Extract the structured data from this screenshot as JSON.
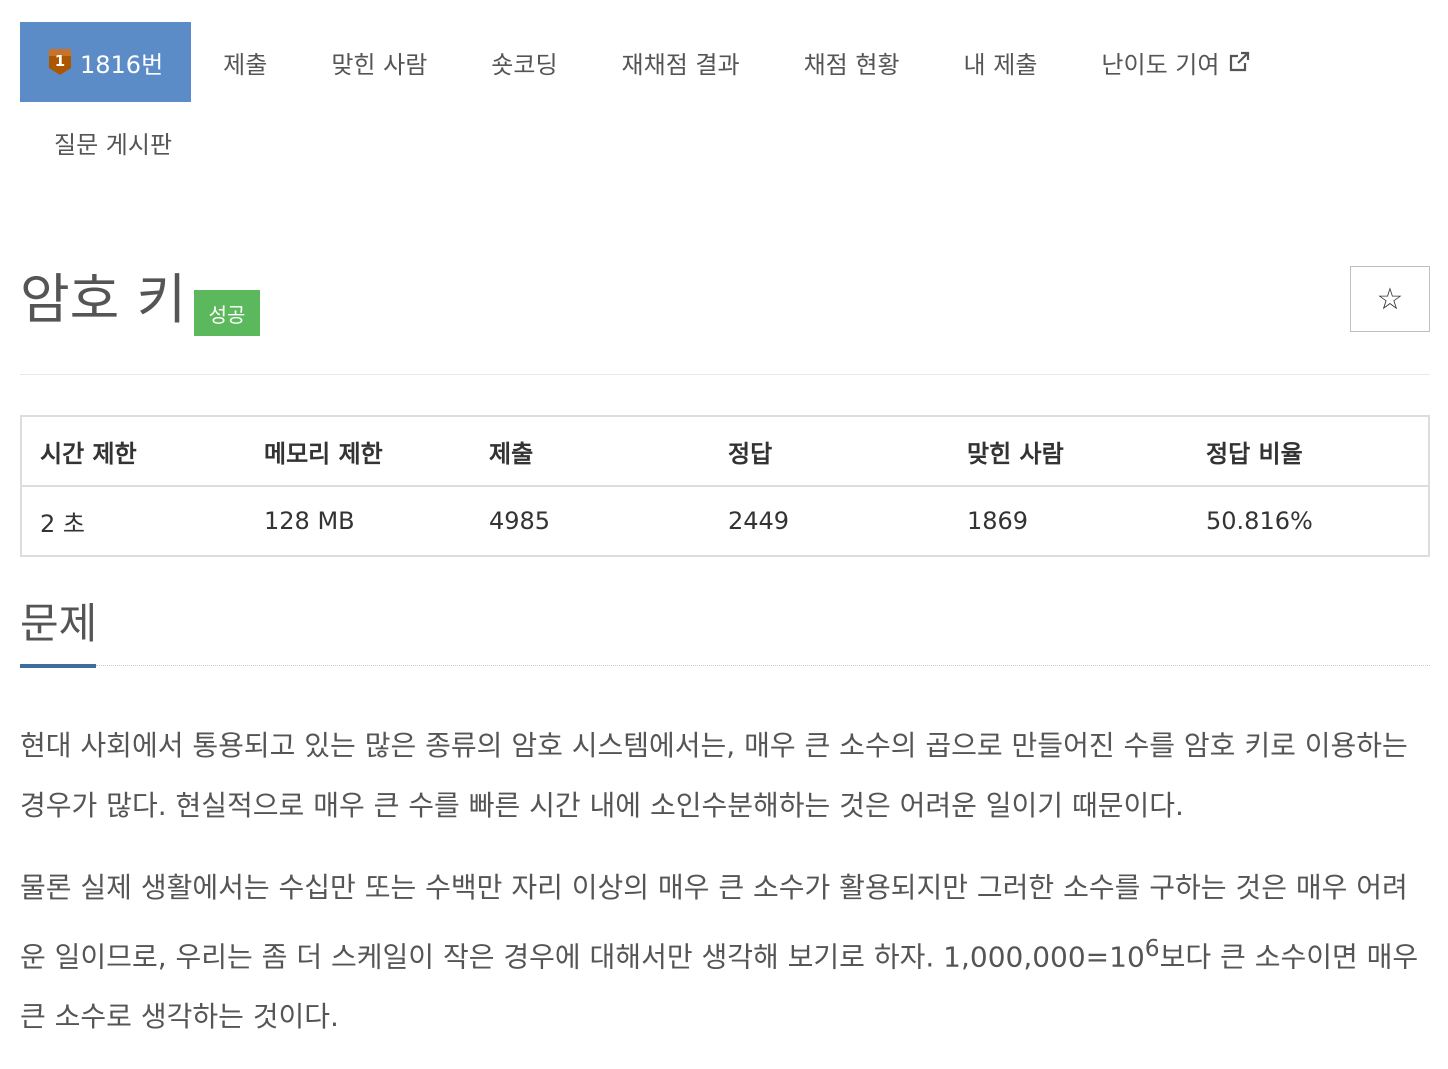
{
  "nav": {
    "items": [
      {
        "label": "1816번",
        "tier": "1"
      },
      {
        "label": "제출"
      },
      {
        "label": "맞힌 사람"
      },
      {
        "label": "숏코딩"
      },
      {
        "label": "재채점 결과"
      },
      {
        "label": "채점 현황"
      },
      {
        "label": "내 제출"
      },
      {
        "label": "난이도 기여"
      },
      {
        "label": "질문 게시판"
      }
    ]
  },
  "problem": {
    "title": "암호 키",
    "badge": "성공",
    "star": "☆"
  },
  "info_table": {
    "headers": [
      "시간 제한",
      "메모리 제한",
      "제출",
      "정답",
      "맞힌 사람",
      "정답 비율"
    ],
    "values": [
      "2 초",
      "128 MB",
      "4985",
      "2449",
      "1869",
      "50.816%"
    ]
  },
  "section": {
    "title": "문제",
    "paragraph1": "현대 사회에서 통용되고 있는 많은 종류의 암호 시스템에서는, 매우 큰 소수의 곱으로 만들어진 수를 암호 키로 이용하는 경우가 많다. 현실적으로 매우 큰 수를 빠른 시간 내에 소인수분해하는 것은 어려운 일이기 때문이다.",
    "paragraph2_a": "물론 실제 생활에서는 수십만 또는 수백만 자리 이상의 매우 큰 소수가 활용되지만 그러한 소수를 구하는 것은 매우 어려운 일이므로, 우리는 좀 더 스케일이 작은 경우에 대해서만 생각해 보기로 하자. 1,000,000=10",
    "paragraph2_sup": "6",
    "paragraph2_b": "보다 큰 소수이면 매우 큰 소수로 생각하는 것이다."
  },
  "colors": {
    "active_tab": "#5b8cc8",
    "success_badge": "#5cb85c",
    "tier_bronze": "#ad5600",
    "section_underline": "#3d6e9e"
  },
  "icons": [
    "bronze-tier-icon",
    "external-link-icon",
    "star-icon"
  ]
}
